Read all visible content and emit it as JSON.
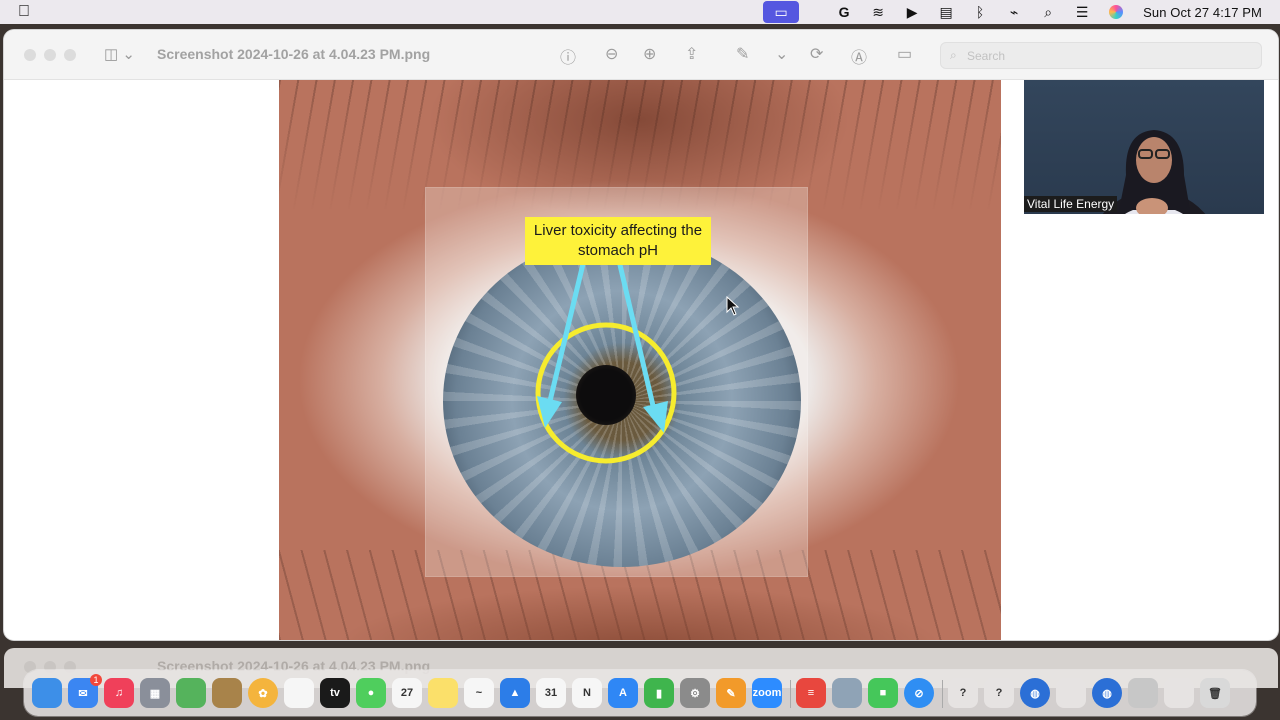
{
  "menubar": {
    "clock": "Sun Oct 27  4:17 PM",
    "icons": [
      "apple-icon",
      "screen-share-icon",
      "grammarly-icon",
      "stack-icon",
      "play-icon",
      "calendar-app-icon",
      "bluetooth-icon",
      "wifi-off-icon",
      "search-icon",
      "control-center-icon",
      "siri-icon"
    ]
  },
  "window": {
    "title": "Screenshot 2024-10-26 at 4.04.23 PM.png",
    "search_placeholder": "Search",
    "tools": [
      "info-icon",
      "zoom-out-icon",
      "zoom-in-icon",
      "share-icon",
      "markup-icon",
      "rotate-icon",
      "annotate-icon",
      "form-icon"
    ]
  },
  "image": {
    "callout_text": "Liver toxicity affecting the stomach pH",
    "colors": {
      "callout_bg": "#fef23a",
      "circle": "#f6ec2e",
      "arrow": "#6bdcf2"
    }
  },
  "video": {
    "speaker_name": "Vital Life Energy"
  },
  "background_window": {
    "title": "Screenshot 2024-10-26 at 4.04.23 PM.png"
  },
  "dock": {
    "items": [
      {
        "name": "finder",
        "color": "#3d8fe8",
        "glyph": ""
      },
      {
        "name": "mail",
        "color": "#3b86f2",
        "glyph": "✉",
        "badge": "1"
      },
      {
        "name": "music",
        "color": "#f0405a",
        "glyph": "♫"
      },
      {
        "name": "launchpad",
        "color": "#8a8f9a",
        "glyph": "▦"
      },
      {
        "name": "maps",
        "color": "#55b35c",
        "glyph": ""
      },
      {
        "name": "notes-folder",
        "color": "#a8834a",
        "glyph": ""
      },
      {
        "name": "photos",
        "color": "#f4b43d",
        "glyph": "✿"
      },
      {
        "name": "reminders",
        "color": "#f6f6f6",
        "glyph": ""
      },
      {
        "name": "apple-tv",
        "color": "#1a1a1a",
        "glyph": "tv"
      },
      {
        "name": "messages",
        "color": "#4fce5d",
        "glyph": "●"
      },
      {
        "name": "calendar",
        "color": "#f6f6f6",
        "glyph": "27"
      },
      {
        "name": "notes",
        "color": "#fbe06a",
        "glyph": ""
      },
      {
        "name": "freeform",
        "color": "#f6f6f6",
        "glyph": "~"
      },
      {
        "name": "keynote",
        "color": "#2c7de8",
        "glyph": "▲"
      },
      {
        "name": "google-calendar",
        "color": "#f6f6f6",
        "glyph": "31"
      },
      {
        "name": "news",
        "color": "#f6f6f6",
        "glyph": "N"
      },
      {
        "name": "app-store",
        "color": "#2f87f5",
        "glyph": "A"
      },
      {
        "name": "numbers",
        "color": "#3fb54d",
        "glyph": "▮"
      },
      {
        "name": "system-settings",
        "color": "#8b8b8b",
        "glyph": "⚙"
      },
      {
        "name": "pages",
        "color": "#f29a2a",
        "glyph": "✎"
      },
      {
        "name": "zoom",
        "color": "#2d8cff",
        "glyph": "zoom"
      },
      {
        "name": "scripts",
        "color": "#e8473e",
        "glyph": "≡"
      },
      {
        "name": "preview",
        "color": "#8fa3b6",
        "glyph": ""
      },
      {
        "name": "facetime",
        "color": "#45c75a",
        "glyph": "■"
      },
      {
        "name": "safari",
        "color": "#2f8ef3",
        "glyph": "⊘"
      },
      {
        "name": "help",
        "color": "#e6e3e2",
        "glyph": "?"
      },
      {
        "name": "help-2",
        "color": "#e6e3e2",
        "glyph": "?"
      },
      {
        "name": "globe",
        "color": "#2b6fd6",
        "glyph": "◍"
      },
      {
        "name": "browser-blank",
        "color": "#e6e3e2",
        "glyph": ""
      },
      {
        "name": "globe-2",
        "color": "#2b6fd6",
        "glyph": "◍"
      },
      {
        "name": "disk",
        "color": "#c7c7c7",
        "glyph": ""
      },
      {
        "name": "gear-blank",
        "color": "#e6e3e2",
        "glyph": ""
      },
      {
        "name": "trash",
        "color": "#d9d9d9",
        "glyph": "🗑"
      }
    ]
  }
}
